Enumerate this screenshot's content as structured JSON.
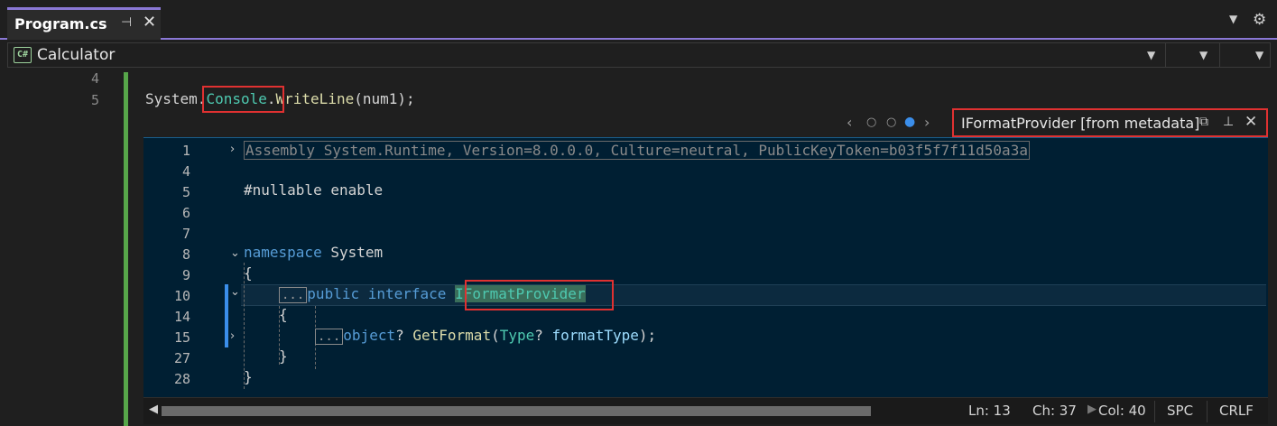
{
  "tab": {
    "title": "Program.cs",
    "pin_icon": "pin-icon",
    "close_icon": "close-icon"
  },
  "toolbar": {
    "dropdown_icon": "chevron-down-icon",
    "settings_icon": "gear-icon"
  },
  "navbar": {
    "project_icon_text": "C#",
    "project": "Calculator"
  },
  "editor": {
    "lines": [
      {
        "num": "4"
      },
      {
        "num": "5"
      }
    ],
    "line5": {
      "tok1": "System",
      "dot1": ".",
      "tok2": "Console",
      "dot2": ".",
      "tok3": "WriteLine",
      "tok4": "(num1);"
    }
  },
  "peek": {
    "title": "IFormatProvider [from metadata]",
    "nav_prev": "‹",
    "nav_next": "›",
    "lines": [
      {
        "num": "1"
      },
      {
        "num": "4"
      },
      {
        "num": "5"
      },
      {
        "num": "6"
      },
      {
        "num": "7"
      },
      {
        "num": "8"
      },
      {
        "num": "9"
      },
      {
        "num": "10"
      },
      {
        "num": "14"
      },
      {
        "num": "15"
      },
      {
        "num": "27"
      },
      {
        "num": "28"
      }
    ],
    "assembly": "Assembly System.Runtime, Version=8.0.0.0, Culture=neutral, PublicKeyToken=b03f5f7f11d50a3a",
    "nullable": "#nullable enable",
    "namespace_kw": "namespace",
    "namespace_name": "System",
    "open_brace": "{",
    "close_brace": "}",
    "collapsed_marker": "...",
    "public_kw": "public",
    "interface_kw": "interface",
    "interface_name": "IFormatProvider",
    "object_kw": "object",
    "q1": "?",
    "method_name": "GetFormat",
    "paren_open": "(",
    "type_name": "Type",
    "q2": "?",
    "param_name": "formatType",
    "paren_close": ");"
  },
  "status": {
    "ln": "Ln: 13",
    "ch": "Ch: 37",
    "col": "Col: 40",
    "spc": "SPC",
    "crlf": "CRLF"
  },
  "colors": {
    "accent": "#8a78d6",
    "highlight_box": "#e03131",
    "peek_bg": "#001f33",
    "change_bar": "#57a64a"
  }
}
